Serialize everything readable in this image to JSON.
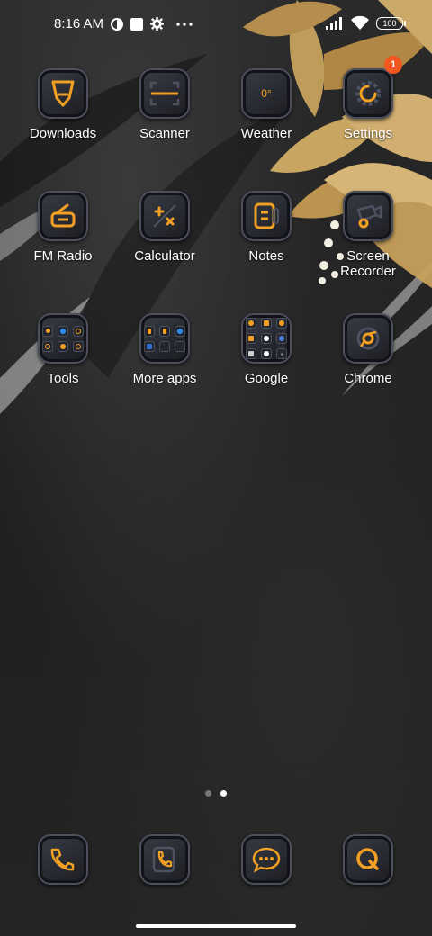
{
  "status_bar": {
    "time": "8:16 AM",
    "battery": "100",
    "icons": [
      "data-saver-icon",
      "square-notification-icon",
      "gear-icon",
      "more-dots-icon",
      "signal-icon",
      "wifi-icon",
      "battery-icon"
    ]
  },
  "apps": [
    {
      "label": "Downloads",
      "icon": "download-icon"
    },
    {
      "label": "Scanner",
      "icon": "scanner-icon"
    },
    {
      "label": "Weather",
      "icon": "weather-icon",
      "icon_text": "0°"
    },
    {
      "label": "Settings",
      "icon": "settings-gear-icon",
      "badge": "1"
    },
    {
      "label": "FM Radio",
      "icon": "radio-icon"
    },
    {
      "label": "Calculator",
      "icon": "calculator-icon"
    },
    {
      "label": "Notes",
      "icon": "notes-icon"
    },
    {
      "label": "Screen\nRecorder",
      "icon": "video-camera-icon"
    },
    {
      "label": "Tools",
      "icon": "folder-icon"
    },
    {
      "label": "More apps",
      "icon": "folder-icon"
    },
    {
      "label": "Google",
      "icon": "folder-icon"
    },
    {
      "label": "Chrome",
      "icon": "chrome-icon"
    }
  ],
  "dock": [
    {
      "icon": "phone-icon"
    },
    {
      "icon": "contacts-phone-icon"
    },
    {
      "icon": "messages-icon"
    },
    {
      "icon": "browser-q-icon"
    }
  ],
  "pages": {
    "count": 2,
    "active": 2
  },
  "colors": {
    "accent": "#f2a024",
    "badge": "#f0561d"
  }
}
